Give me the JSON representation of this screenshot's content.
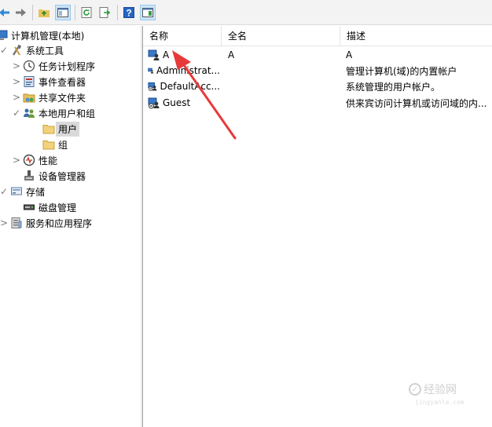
{
  "toolbar": {
    "buttons": [
      {
        "name": "back-button",
        "icon": "back-arrow-icon"
      },
      {
        "name": "forward-button",
        "icon": "forward-arrow-icon"
      },
      {
        "name": "up-button",
        "icon": "folder-up-icon"
      },
      {
        "name": "show-hide-tree-button",
        "icon": "console-tree-icon"
      },
      {
        "name": "refresh-button",
        "icon": "refresh-icon"
      },
      {
        "name": "export-list-button",
        "icon": "export-icon"
      },
      {
        "name": "help-button",
        "icon": "help-icon",
        "glyph": "?"
      },
      {
        "name": "action-pane-button",
        "icon": "action-pane-icon"
      }
    ]
  },
  "tree": {
    "items": [
      {
        "label": "计算机管理(本地)",
        "icon": "computer-icon",
        "expander": ""
      },
      {
        "label": "系统工具",
        "icon": "tools-icon",
        "expander": "✓"
      },
      {
        "label": "任务计划程序",
        "icon": "clock-icon",
        "expander": ">"
      },
      {
        "label": "事件查看器",
        "icon": "event-viewer-icon",
        "expander": ">"
      },
      {
        "label": "共享文件夹",
        "icon": "shared-folder-icon",
        "expander": ">"
      },
      {
        "label": "本地用户和组",
        "icon": "users-group-icon",
        "expander": "✓"
      },
      {
        "label": "用户",
        "icon": "folder-icon",
        "expander": ""
      },
      {
        "label": "组",
        "icon": "folder-icon",
        "expander": ""
      },
      {
        "label": "性能",
        "icon": "performance-icon",
        "expander": ">"
      },
      {
        "label": "设备管理器",
        "icon": "device-manager-icon",
        "expander": ""
      },
      {
        "label": "存储",
        "icon": "storage-icon",
        "expander": "✓"
      },
      {
        "label": "磁盘管理",
        "icon": "disk-icon",
        "expander": ""
      },
      {
        "label": "服务和应用程序",
        "icon": "services-icon",
        "expander": ">"
      }
    ]
  },
  "list": {
    "columns": [
      "名称",
      "全名",
      "描述"
    ],
    "rows": [
      {
        "name": "A",
        "full_name": "A",
        "description": "A"
      },
      {
        "name": "Administrat...",
        "full_name": "",
        "description": "管理计算机(域)的内置帐户"
      },
      {
        "name": "DefaultAcc...",
        "full_name": "",
        "description": "系统管理的用户帐户。"
      },
      {
        "name": "Guest",
        "full_name": "",
        "description": "供来宾访问计算机或访问域的内..."
      }
    ]
  },
  "colors": {
    "accent_arrow": "#e8393a",
    "selection": "#d9d9d9",
    "toolbar_bg": "#f3f3f3"
  },
  "watermark": {
    "text": "经验网",
    "url": "jingyanla.com"
  }
}
